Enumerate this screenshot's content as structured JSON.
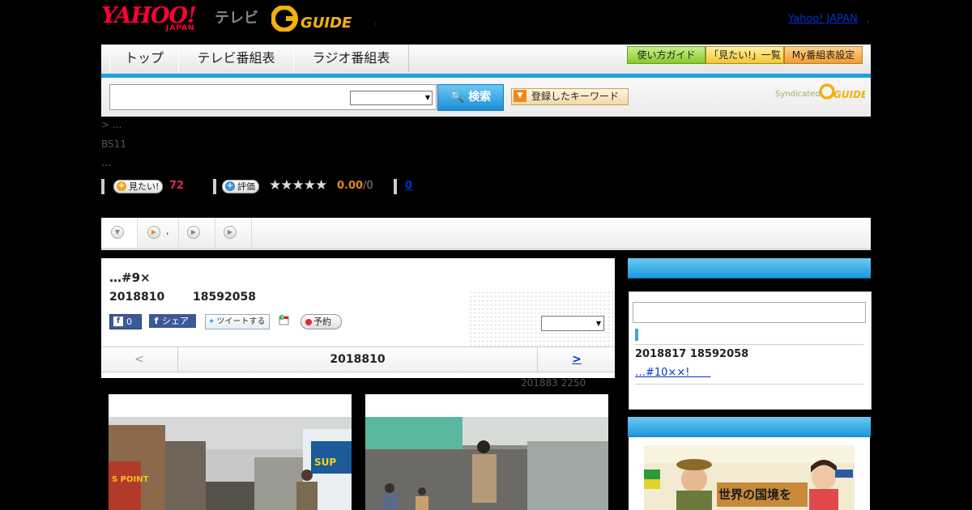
{
  "header": {
    "logo_yahoo": "YAHOO!",
    "logo_japan": "JAPAN",
    "logo_tv": "テレビ",
    "logo_gguide": "G-GUIDE",
    "small_dot": ",",
    "top_link": "Yahoo! JAPAN",
    "top_dot": ","
  },
  "nav": {
    "tabs": [
      "トップ",
      "テレビ番組表",
      "ラジオ番組表"
    ],
    "buttons": [
      "使い方ガイド",
      "「見たい!」一覧",
      "My番組表設定"
    ]
  },
  "search": {
    "input_value": "",
    "select_value": "",
    "button_label": "検索",
    "keyword_button": "登録したキーワード",
    "syndicated": "Syndicated",
    "syndicated_logo": "G-GUIDE"
  },
  "info": {
    "breadcrumb": "> ...",
    "channel": "BS11",
    "ellipsis": "...",
    "want_button": "見たい!",
    "want_count": "72",
    "rate_button": "評価",
    "stars": "★★★★★",
    "score": "0.00",
    "score_total": "/0",
    "review_count": "0"
  },
  "tabs": {
    "tab2_label": ","
  },
  "program": {
    "title": "…#9×",
    "date": "2018810",
    "time": "18592058",
    "like_count": "0",
    "share_label": "シェア",
    "tweet_label": "ツイートする",
    "reserve_label": "予約",
    "select_value": "",
    "prev_label": "<",
    "current_date": "2018810",
    "next_label": ">",
    "updated": "201883  2250"
  },
  "sidebar": {
    "header1": "",
    "input_value": "",
    "item_date": "2018817  18592058",
    "item_link": "…#10××!　　"
  },
  "banner": {
    "headline": "世界の国境を"
  },
  "colors": {
    "accent_blue": "#1ea0e0",
    "link": "#0033cc",
    "want_pink": "#e0206a",
    "score_orange": "#e08a1a"
  }
}
